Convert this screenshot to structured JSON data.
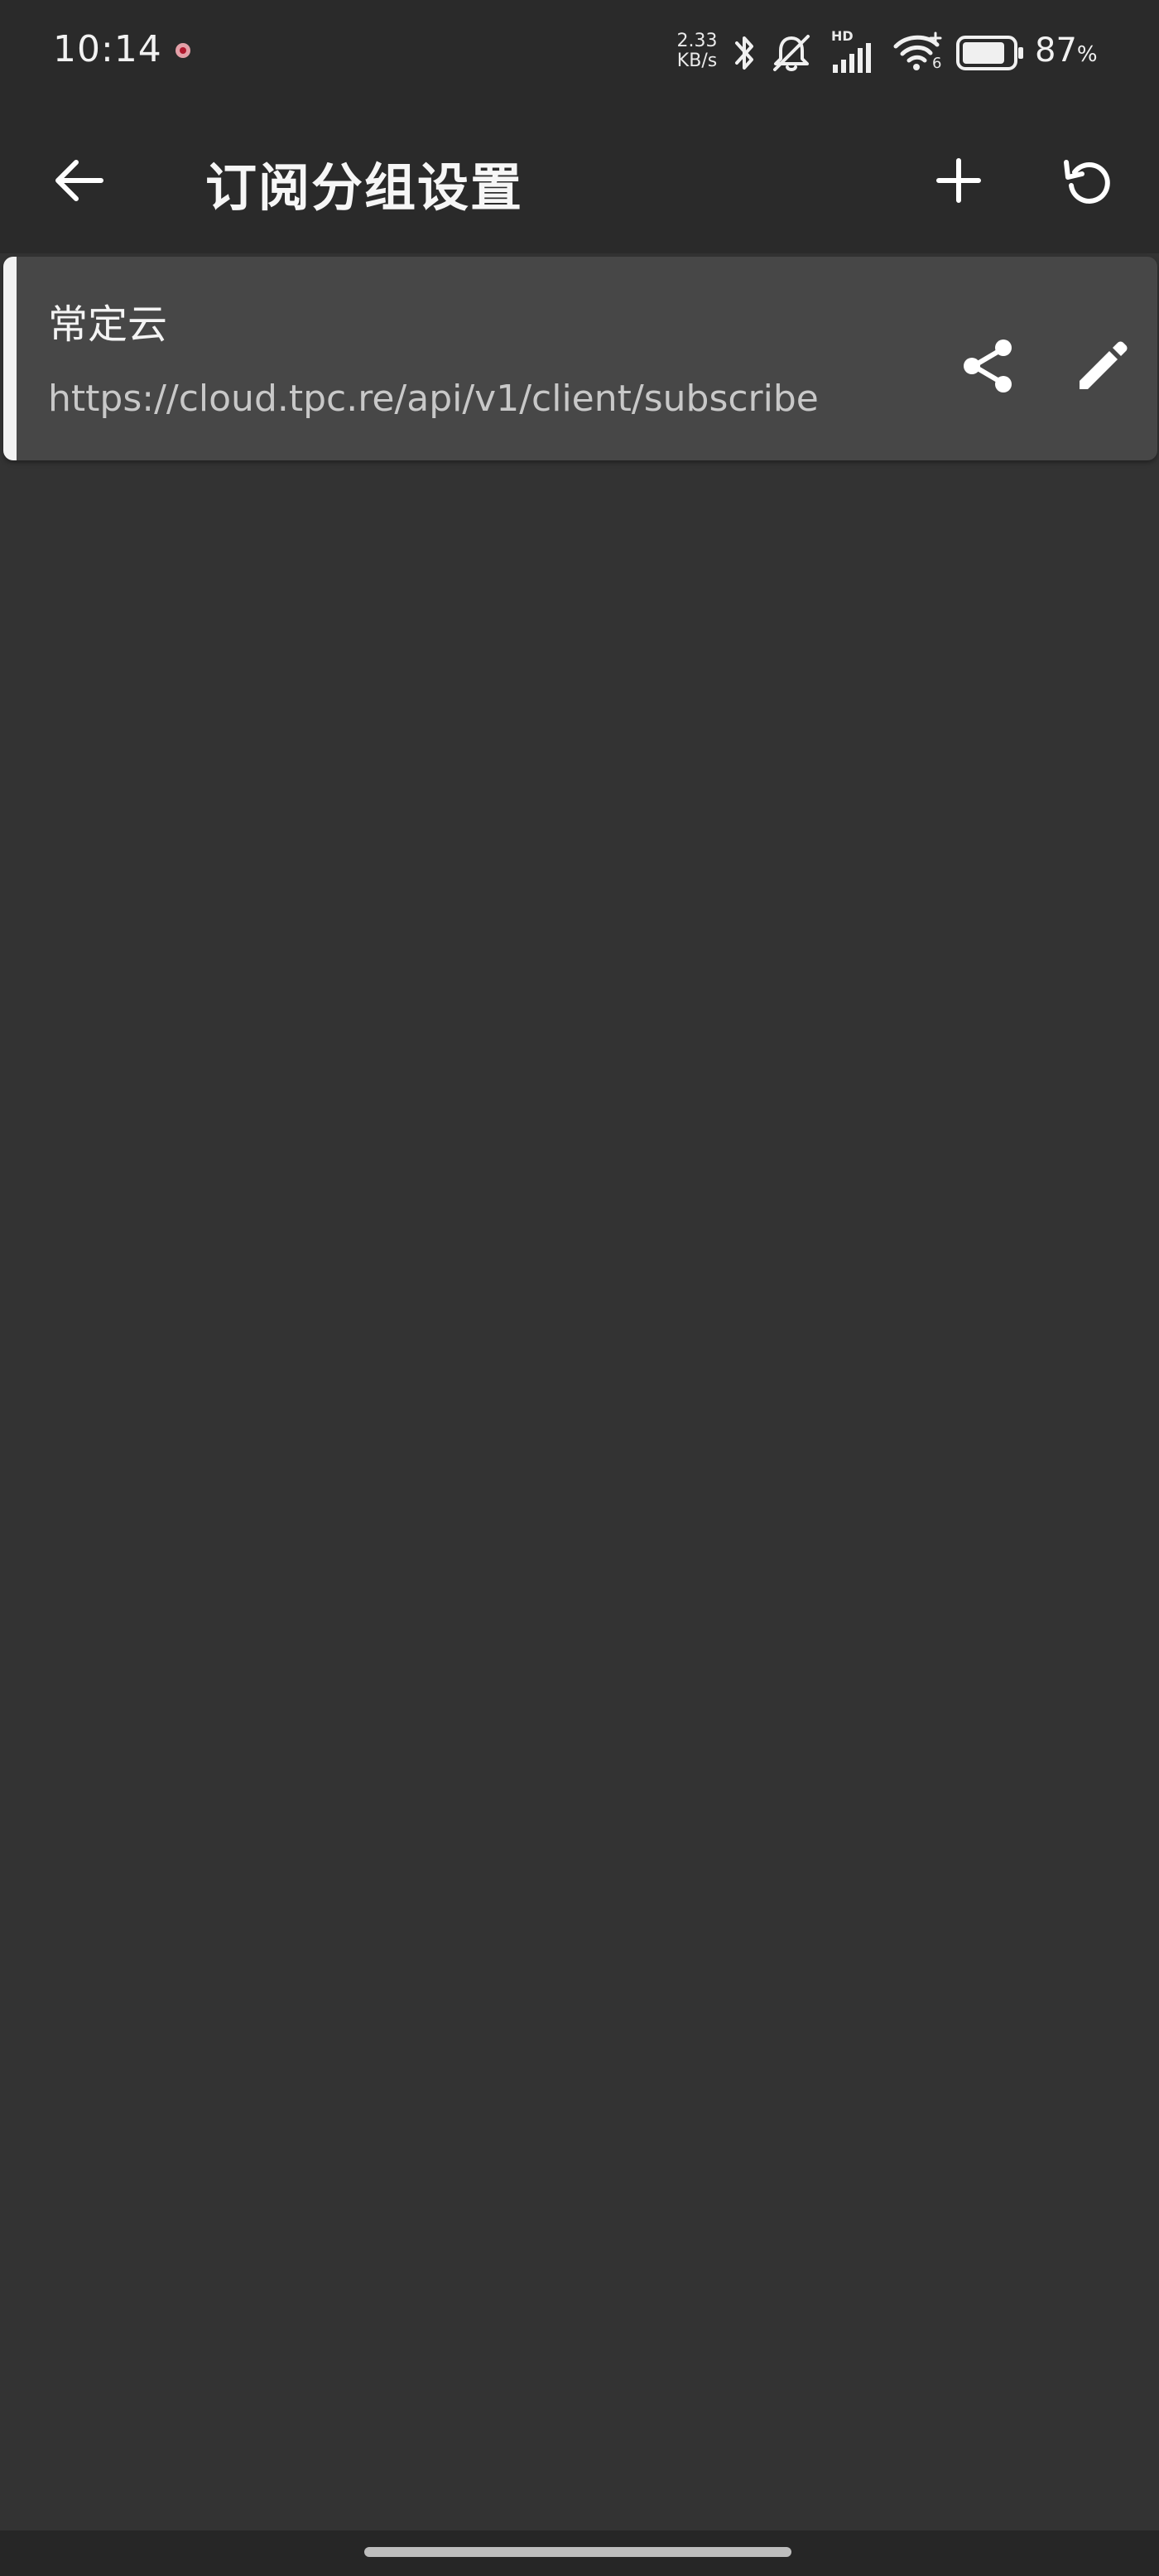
{
  "status_bar": {
    "time": "10:14",
    "net_speed_value": "2.33",
    "net_speed_unit": "KB/s",
    "signal_badge": "HD",
    "wifi_badge": "6",
    "battery_percent": "87",
    "battery_unit": "%",
    "battery_level": 0.87,
    "icons": [
      "recording-dot-icon",
      "bluetooth-icon",
      "mute-bell-icon",
      "cell-signal-icon",
      "wifi-icon",
      "battery-icon"
    ]
  },
  "app_bar": {
    "title": "订阅分组设置",
    "actions": [
      "back-arrow-icon",
      "add-icon",
      "refresh-icon"
    ]
  },
  "subscriptions": [
    {
      "name": "常定云",
      "url": "https://cloud.tpc.re/api/v1/client/subscribe",
      "actions": [
        "share-icon",
        "edit-pencil-icon"
      ]
    }
  ],
  "colors": {
    "background": "#333333",
    "app_bar": "#2a2a2a",
    "card": "#474747",
    "accent_bar": "#f2f2f2",
    "url_text": "#c8c8c8"
  }
}
